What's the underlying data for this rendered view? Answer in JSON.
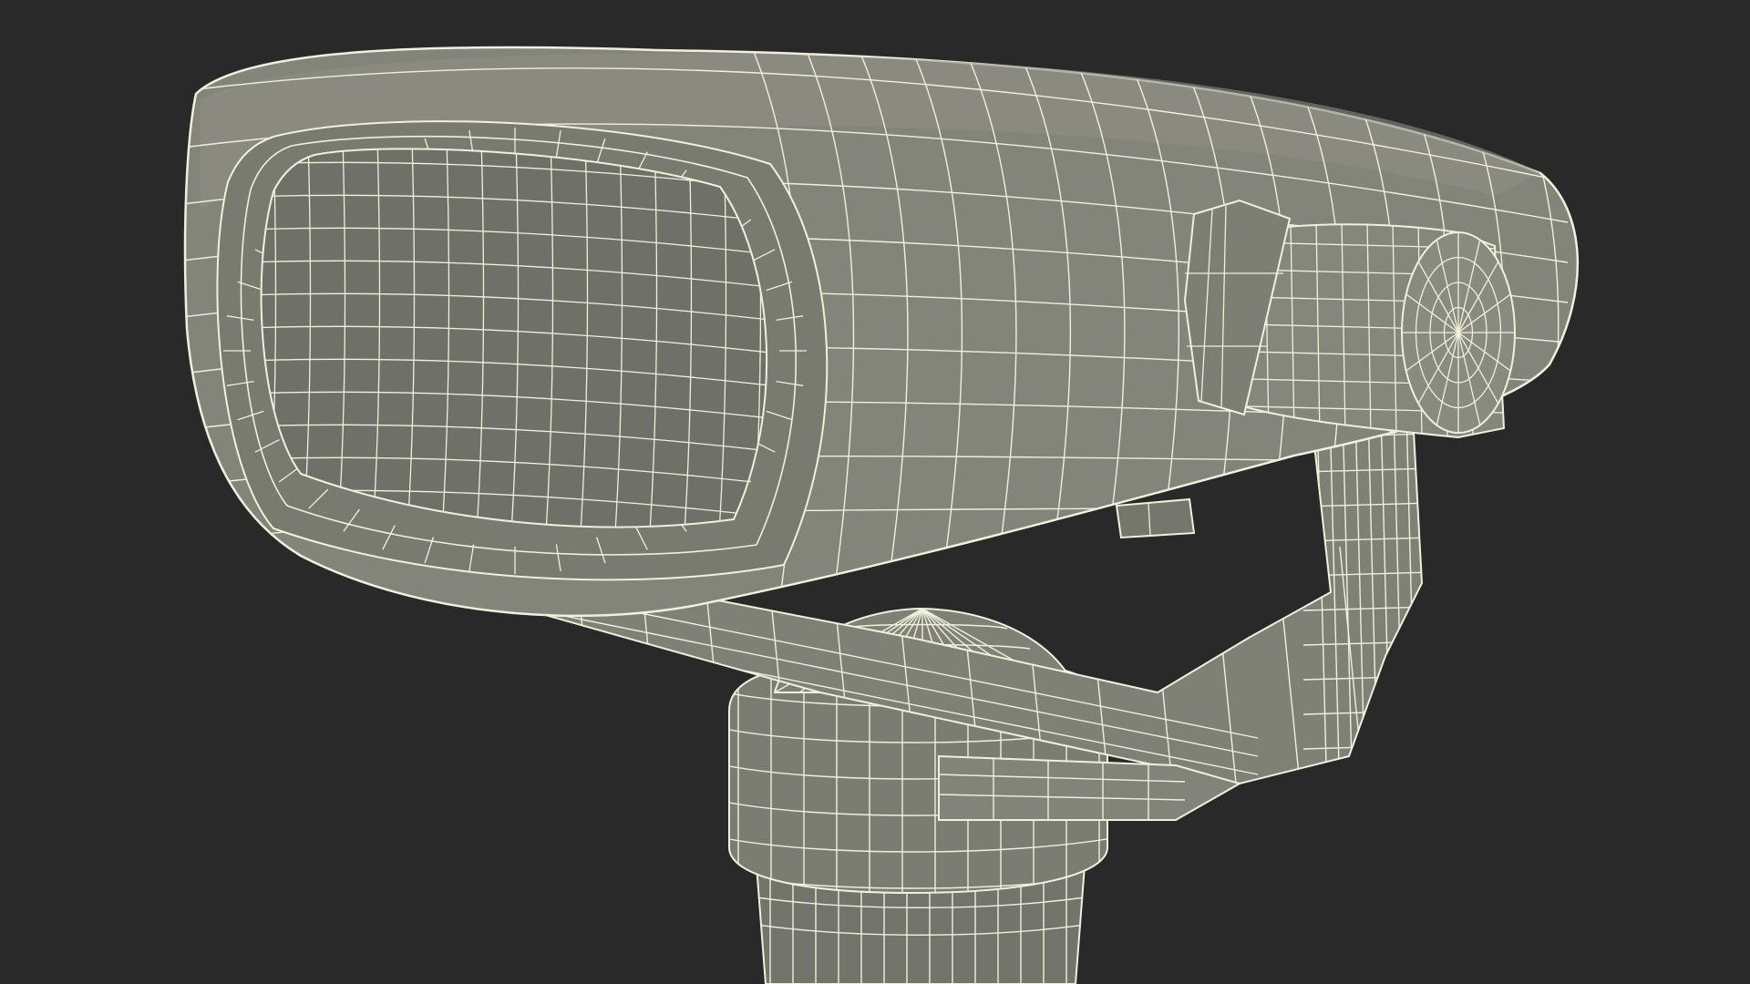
{
  "scene": {
    "subject": "coin-operated-binocular-viewer",
    "render_style": "wireframe-over-clay",
    "colors": {
      "background": "#292929",
      "body": "#84857a",
      "body_light": "#8f9085",
      "body_dark": "#6c6d63",
      "lens": "#6f7068",
      "wire": "#f1f0dc"
    }
  }
}
